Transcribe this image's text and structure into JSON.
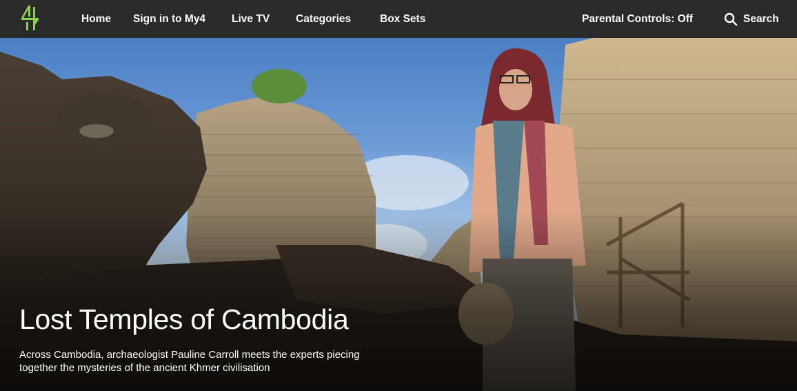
{
  "nav": {
    "logo_icon": "channel-4-logo-icon",
    "home": "Home",
    "sign_in": "Sign in to My4",
    "live_tv": "Live TV",
    "categories": "Categories",
    "box_sets": "Box Sets",
    "parental_controls": "Parental Controls: Off",
    "search": "Search",
    "search_icon": "search-icon"
  },
  "hero": {
    "title": "Lost Temples of Cambodia",
    "description": "Across Cambodia, archaeologist Pauline Carroll meets the experts piecing together the mysteries of the ancient Khmer civilisation"
  },
  "colors": {
    "nav_bg": "#2a2a2a",
    "logo_green": "#8ad150",
    "text": "#ffffff"
  }
}
